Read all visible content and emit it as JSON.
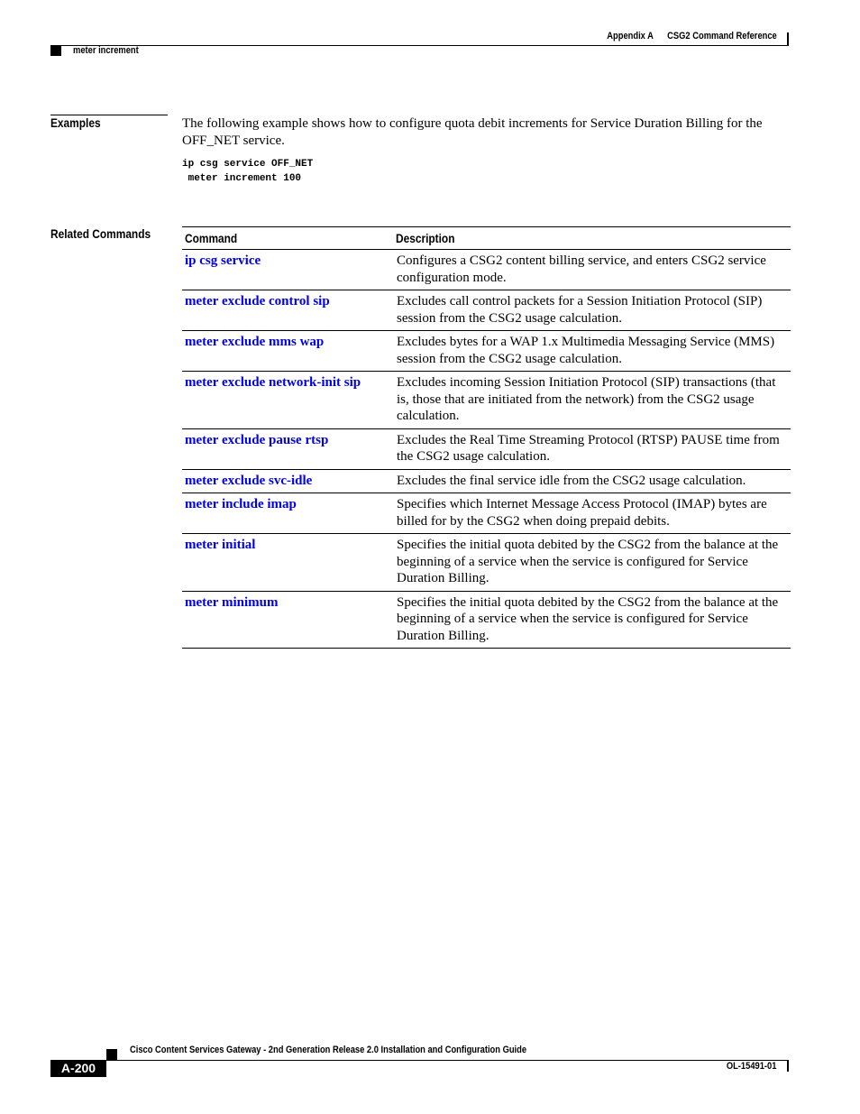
{
  "header": {
    "appendix": "Appendix A",
    "chapter": "CSG2 Command Reference",
    "command": "meter increment"
  },
  "examples": {
    "label": "Examples",
    "text": "The following example shows how to configure quota debit increments for Service Duration Billing for the OFF_NET service.",
    "code": "ip csg service OFF_NET\n meter increment 100"
  },
  "related": {
    "label": "Related Commands",
    "columns": [
      "Command",
      "Description"
    ],
    "rows": [
      {
        "command": "ip csg service",
        "description": "Configures a CSG2 content billing service, and enters CSG2 service configuration mode."
      },
      {
        "command": "meter exclude control sip",
        "description": "Excludes call control packets for a Session Initiation Protocol (SIP) session from the CSG2 usage calculation."
      },
      {
        "command": "meter exclude mms wap",
        "description": "Excludes bytes for a WAP 1.x Multimedia Messaging Service (MMS) session from the CSG2 usage calculation."
      },
      {
        "command": "meter exclude network-init sip",
        "description": "Excludes incoming Session Initiation Protocol (SIP) transactions (that is, those that are initiated from the network) from the CSG2 usage calculation."
      },
      {
        "command": "meter exclude pause rtsp",
        "description": "Excludes the Real Time Streaming Protocol (RTSP) PAUSE time from the CSG2 usage calculation."
      },
      {
        "command": "meter exclude svc-idle",
        "description": "Excludes the final service idle from the CSG2 usage calculation."
      },
      {
        "command": "meter include imap",
        "description": "Specifies which Internet Message Access Protocol (IMAP) bytes are billed for by the CSG2 when doing prepaid debits."
      },
      {
        "command": "meter initial",
        "description": "Specifies the initial quota debited by the CSG2 from the balance at the beginning of a service when the service is configured for Service Duration Billing."
      },
      {
        "command": "meter minimum",
        "description": "Specifies the initial quota debited by the CSG2 from the balance at the beginning of a service when the service is configured for Service Duration Billing."
      }
    ]
  },
  "footer": {
    "guide_title": "Cisco Content Services Gateway - 2nd Generation Release 2.0 Installation and Configuration Guide",
    "page_number": "A-200",
    "doc_number": "OL-15491-01"
  },
  "colors": {
    "link": "#0000ee",
    "text": "#000000"
  }
}
